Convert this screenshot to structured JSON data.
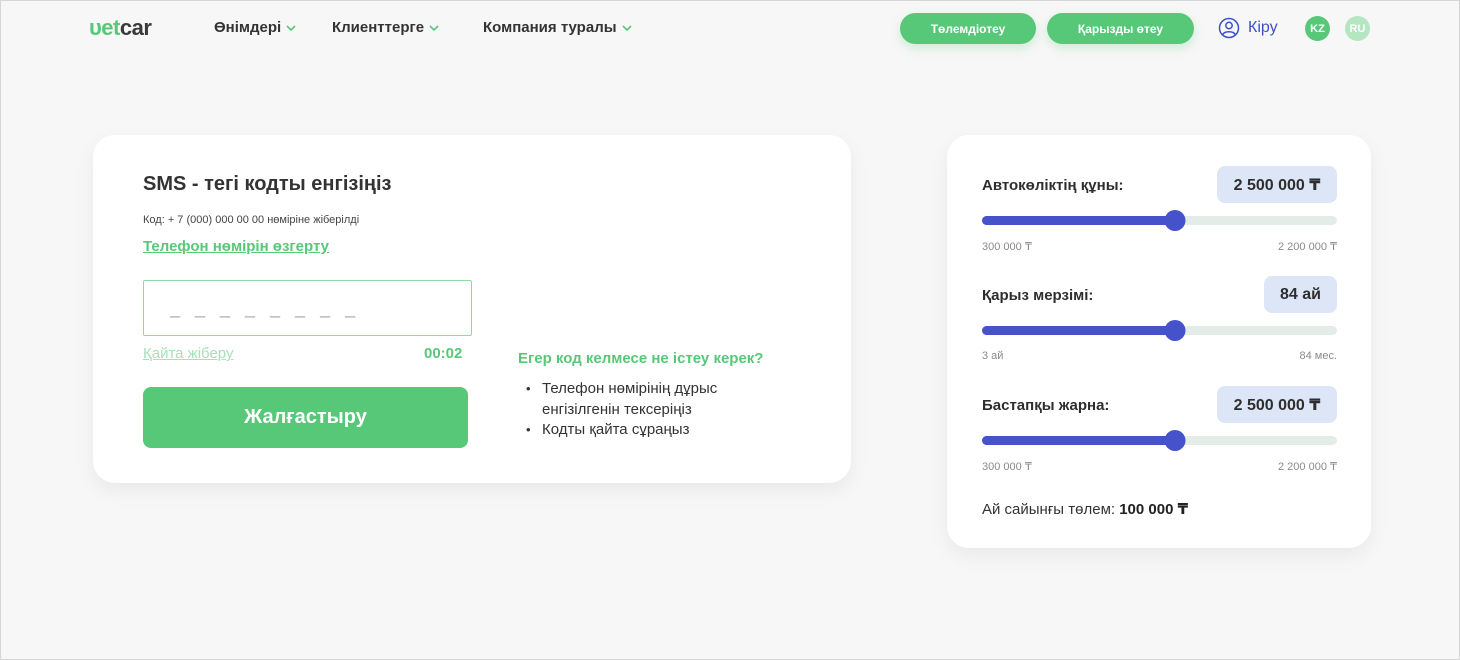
{
  "header": {
    "logo_part1": "υet",
    "logo_part2": "car",
    "nav": [
      "Өнімдері",
      "Клиенттерге",
      "Компания туралы"
    ],
    "pay_button": "Төлемдіотеу",
    "repay_button": "Қарызды өтеу",
    "login": "Кіру",
    "lang_kz": "KZ",
    "lang_ru": "RU"
  },
  "sms": {
    "title": "SMS - тегі кодты енгізіңіз",
    "note": "Код: + 7 (000) 000 00 00 нөміріне жіберілді",
    "change_phone": "Телефон нөмірін өзгерту",
    "code_placeholder": "_ _ _ _ _ _ _ _",
    "resend": "Қайта жіберу",
    "timer": "00:02",
    "continue": "Жалғастыру",
    "help_title": "Егер код келмесе не істеу керек?",
    "help_items": [
      "Телефон нөмірінің дұрыс енгізілгенін тексеріңіз",
      "Кодты қайта сұраңыз"
    ]
  },
  "calculator": {
    "rows": [
      {
        "label": "Автокөліктің құны:",
        "value": "2 500 000 ₸",
        "min": "300 000 ₸",
        "max": "2 200 000 ₸",
        "fraction": 0.545
      },
      {
        "label": "Қарыз мерзімі:",
        "value": "84 ай",
        "min": "3 ай",
        "max": "84 мес.",
        "fraction": 0.545
      },
      {
        "label": "Бастапқы жарна:",
        "value": "2 500 000 ₸",
        "min": "300 000 ₸",
        "max": "2 200 000 ₸",
        "fraction": 0.545
      }
    ],
    "monthly_label": "Ай сайынғы төлем:",
    "monthly_value": "100 000 ₸"
  },
  "colors": {
    "accent_green": "#57c878",
    "slider_blue": "#4552c9",
    "value_box": "#dce6f6"
  }
}
